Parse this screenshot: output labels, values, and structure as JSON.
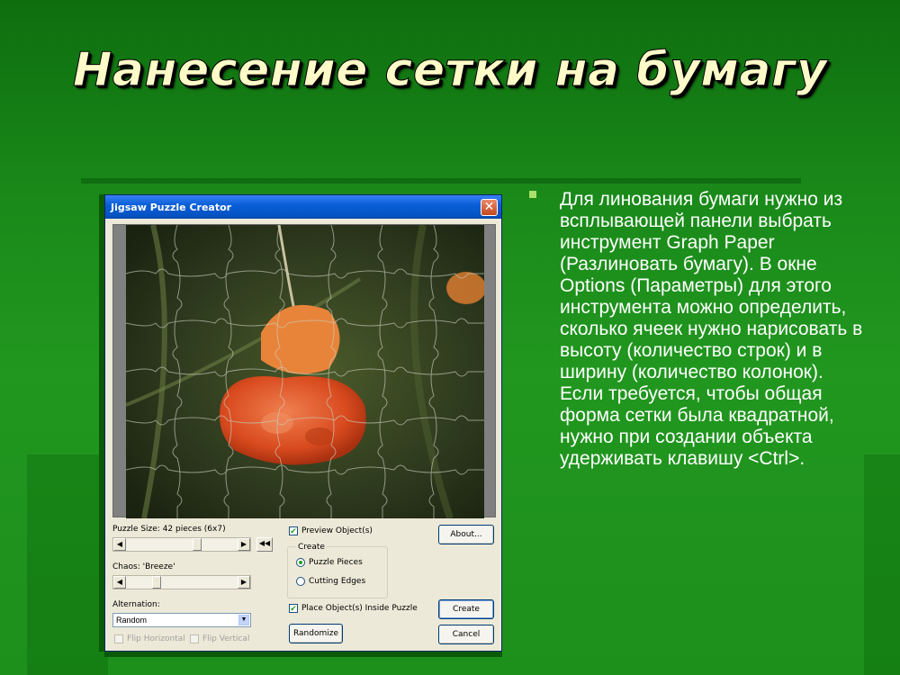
{
  "slide": {
    "title": "Нанесение сетки на бумагу",
    "body": "Для линования бумаги нужно из всплывающей панели выбрать инструмент Graph Paper (Разлиновать бумагу). В окне Options (Параметры) для этого инструмента можно определить, сколько ячеек нужно нарисовать в высоту (количество строк) и в ширину (количество колонок). Если требуется, чтобы общая форма сетки была квадратной, нужно при создании объекта удерживать клавишу <Ctrl>."
  },
  "dialog": {
    "title": "Jigsaw Puzzle Creator",
    "close_glyph": "✕",
    "puzzle_size_label": "Puzzle Size: 42 pieces (6x7)",
    "puzzle_size_value": 0.65,
    "chaos_label": "Chaos: 'Breeze'",
    "chaos_value": 0.25,
    "alternation_label": "Alternation:",
    "alternation_value": "Random",
    "flip_horizontal_label": "Flip Horizontal",
    "flip_vertical_label": "Flip Vertical",
    "preview_objects_label": "Preview Object(s)",
    "create_group_label": "Create",
    "puzzle_pieces_label": "Puzzle Pieces",
    "cutting_edges_label": "Cutting Edges",
    "place_objects_label": "Place Object(s) Inside Puzzle",
    "about_button": "About...",
    "create_button": "Create",
    "cancel_button": "Cancel",
    "randomize_button": "Randomize",
    "arrow_left": "◀",
    "arrow_right": "▶",
    "rewind": "◀◀",
    "dropdown": "▼",
    "check": "✔"
  },
  "colors": {
    "background": "#1a8a1a",
    "title_text": "#fffbc8",
    "bullet": "#a8e06a",
    "flower": "#e0552a"
  }
}
